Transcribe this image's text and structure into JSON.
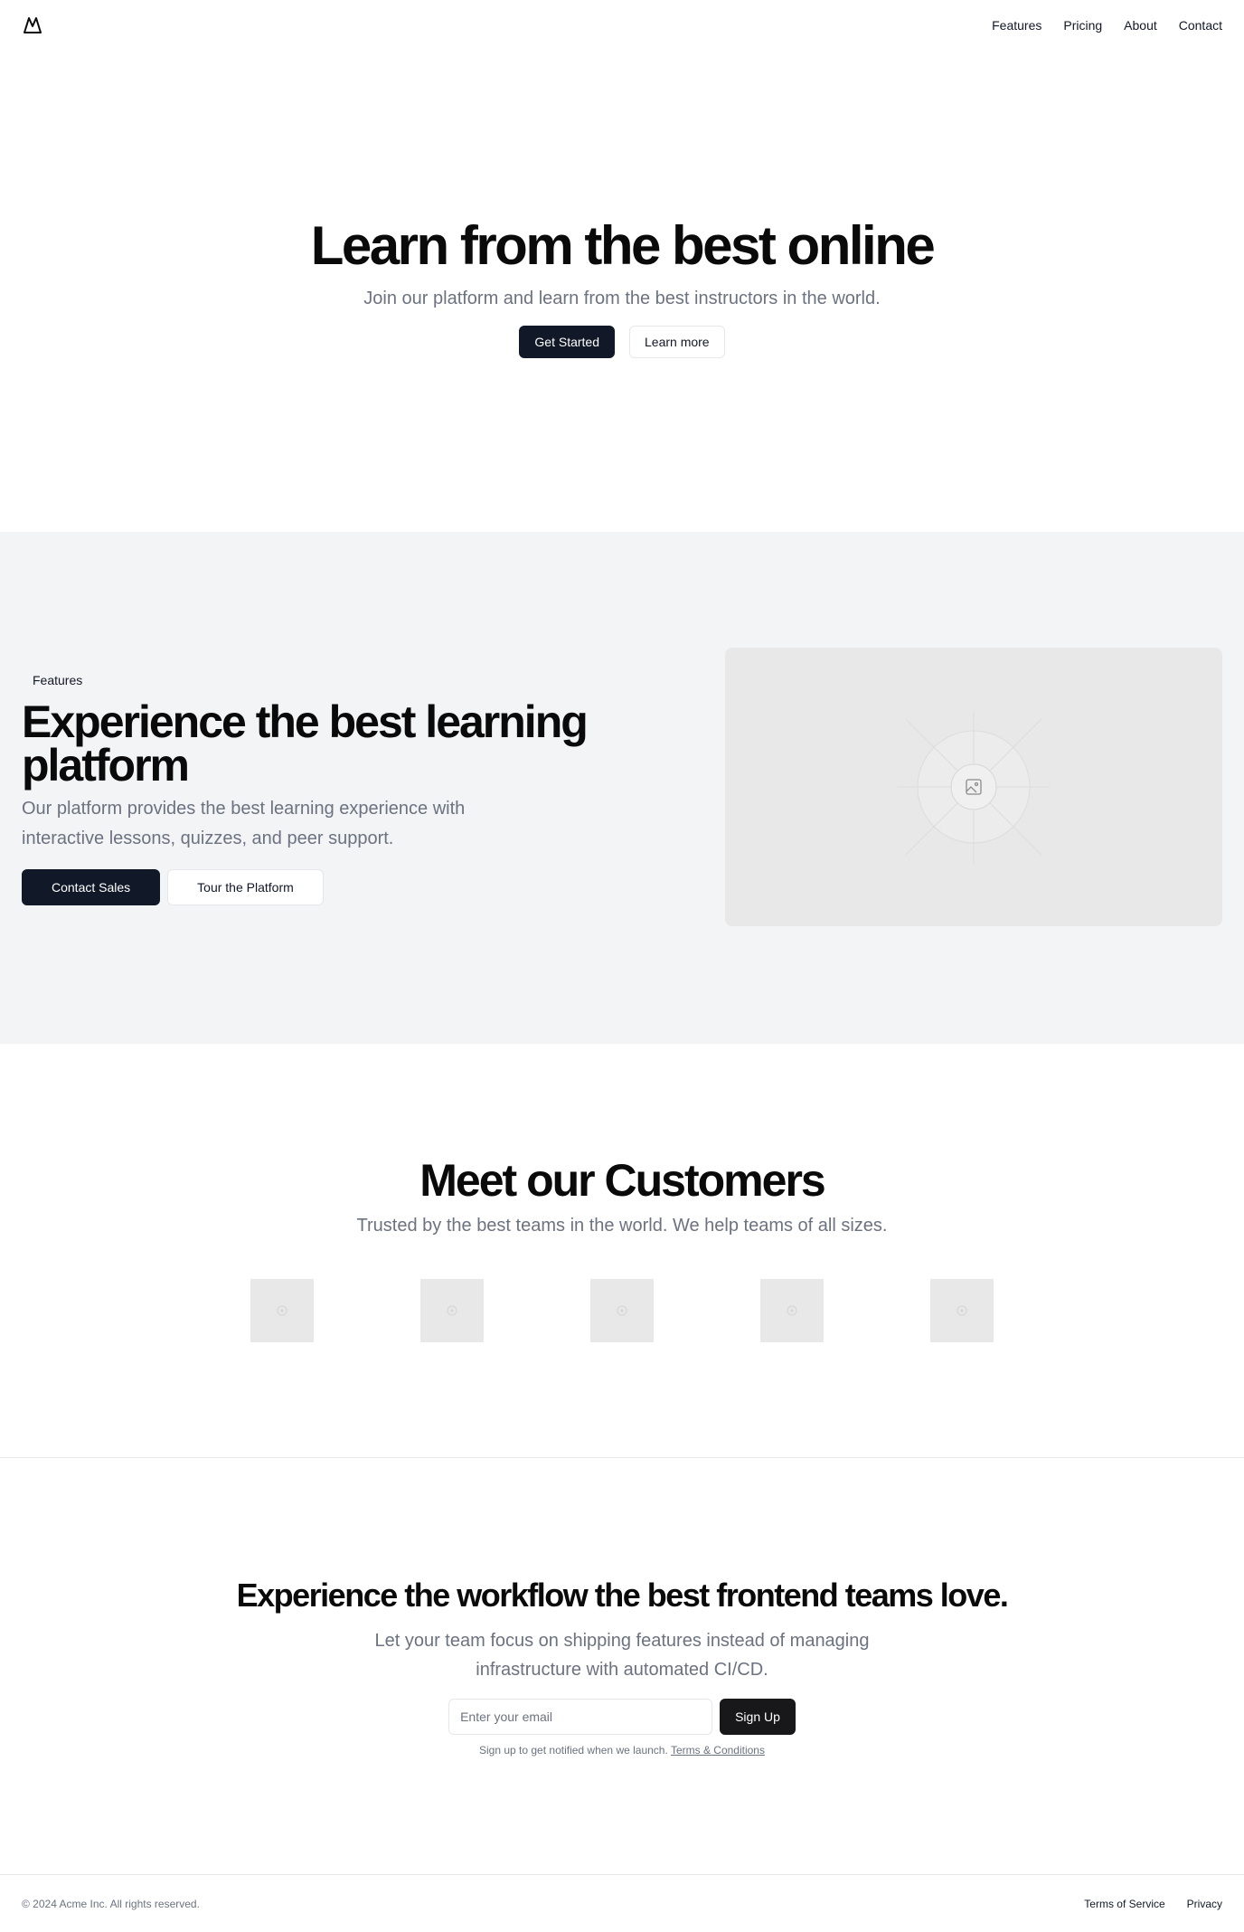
{
  "header": {
    "logo_icon": "mountain-icon",
    "nav": [
      {
        "label": "Features"
      },
      {
        "label": "Pricing"
      },
      {
        "label": "About"
      },
      {
        "label": "Contact"
      }
    ]
  },
  "hero": {
    "title": "Learn from the best online",
    "subtitle": "Join our platform and learn from the best instructors in the world.",
    "primary_button": "Get Started",
    "secondary_button": "Learn more"
  },
  "features": {
    "badge": "Features",
    "title": "Experience the best learning platform",
    "description": "Our platform provides the best learning experience with interactive lessons, quizzes, and peer support.",
    "primary_button": "Contact Sales",
    "secondary_button": "Tour the Platform",
    "image_icon": "image-placeholder-icon"
  },
  "customers": {
    "title": "Meet our Customers",
    "subtitle": "Trusted by the best teams in the world. We help teams of all sizes.",
    "logo_count": 5
  },
  "cta": {
    "title": "Experience the workflow the best frontend teams love.",
    "description": "Let your team focus on shipping features instead of managing infrastructure with automated CI/CD.",
    "email_placeholder": "Enter your email",
    "button": "Sign Up",
    "note": "Sign up to get notified when we launch.",
    "terms_link": "Terms & Conditions"
  },
  "footer": {
    "copyright": "© 2024 Acme Inc. All rights reserved.",
    "links": [
      {
        "label": "Terms of Service"
      },
      {
        "label": "Privacy"
      }
    ]
  },
  "colors": {
    "primary": "#111827",
    "muted_text": "#6b7280",
    "section_bg": "#f3f4f6",
    "placeholder_bg": "#e8e8e8"
  }
}
